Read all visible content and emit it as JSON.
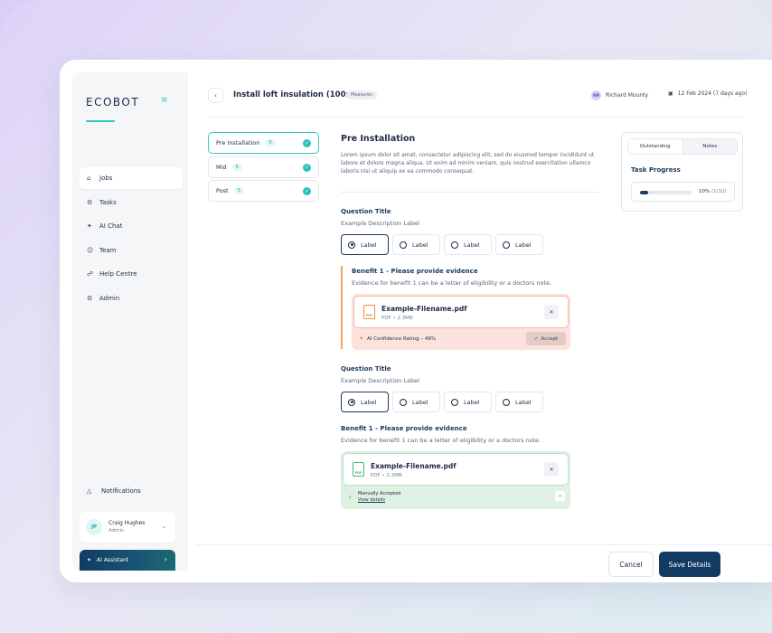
{
  "app": {
    "logo": "ECOBOT"
  },
  "sidebar": {
    "items": [
      {
        "label": "Jobs",
        "icon": "home-icon"
      },
      {
        "label": "Tasks",
        "icon": "tasks-icon"
      },
      {
        "label": "AI Chat",
        "icon": "sparkle-icon"
      },
      {
        "label": "Team",
        "icon": "user-icon"
      },
      {
        "label": "Help Centre",
        "icon": "help-icon"
      },
      {
        "label": "Admin",
        "icon": "gear-icon"
      }
    ],
    "notifications": "Notifications",
    "user": {
      "initials": "JP",
      "name": "Craig Hughes",
      "role": "Admin"
    },
    "ai_assistant": "AI Assistant"
  },
  "header": {
    "title": "Install loft insulation (100mm)",
    "badge": "Measures",
    "author_initials": "RM",
    "author": "Richard Mounty",
    "date": "12 Feb 2024 (7 days ago)"
  },
  "stages": [
    {
      "label": "Pre Installation",
      "count": "5"
    },
    {
      "label": "Mid",
      "count": "5"
    },
    {
      "label": "Post",
      "count": "5"
    }
  ],
  "section": {
    "title": "Pre Installation",
    "description": "Lorem ipsum dolor sit amet, consectetur adipiscing elit, sed do eiusmod tempor incididunt ut labore et dolore magna aliqua. Ut enim ad minim veniam, quis nostrud exercitation ullamco laboris nisi ut aliquip ex ea commodo consequat."
  },
  "questions": [
    {
      "title": "Question Title",
      "description": "Example Description Label",
      "options": [
        "Label",
        "Label",
        "Label",
        "Label"
      ],
      "evidence": {
        "title": "Benefit 1 - Please provide evidence",
        "description": "Evidence for benefit 1 can be a letter of eligibility or a doctors note.",
        "file_name": "Example-Filename.pdf",
        "file_meta": "PDF  •  2.3MB",
        "file_badge": "PDF",
        "confidence": "AI Confidence Rating  –  49%",
        "accept": "Accept"
      }
    },
    {
      "title": "Question Title",
      "description": "Example Description Label",
      "options": [
        "Label",
        "Label",
        "Label",
        "Label"
      ],
      "evidence": {
        "title": "Benefit 1 - Please provide evidence",
        "description": "Evidence for benefit 1 can be a letter of eligibility or a doctors note.",
        "file_name": "Example-Filename.pdf",
        "file_meta": "PDF  •  2.3MB",
        "file_badge": "PDF",
        "status": "Manually Accepted",
        "view_details": "View details"
      }
    }
  ],
  "panel": {
    "tabs": [
      "Outstanding",
      "Notes"
    ],
    "label": "Task Progress",
    "progress_pct": "10%",
    "progress_count": "(1/10)",
    "progress_fraction": 0.1
  },
  "footer": {
    "cancel": "Cancel",
    "save": "Save Details"
  },
  "colors": {
    "accent": "#33c7c0",
    "primary": "#123b63",
    "warning": "#ef8a3c",
    "success": "#47b76a"
  }
}
